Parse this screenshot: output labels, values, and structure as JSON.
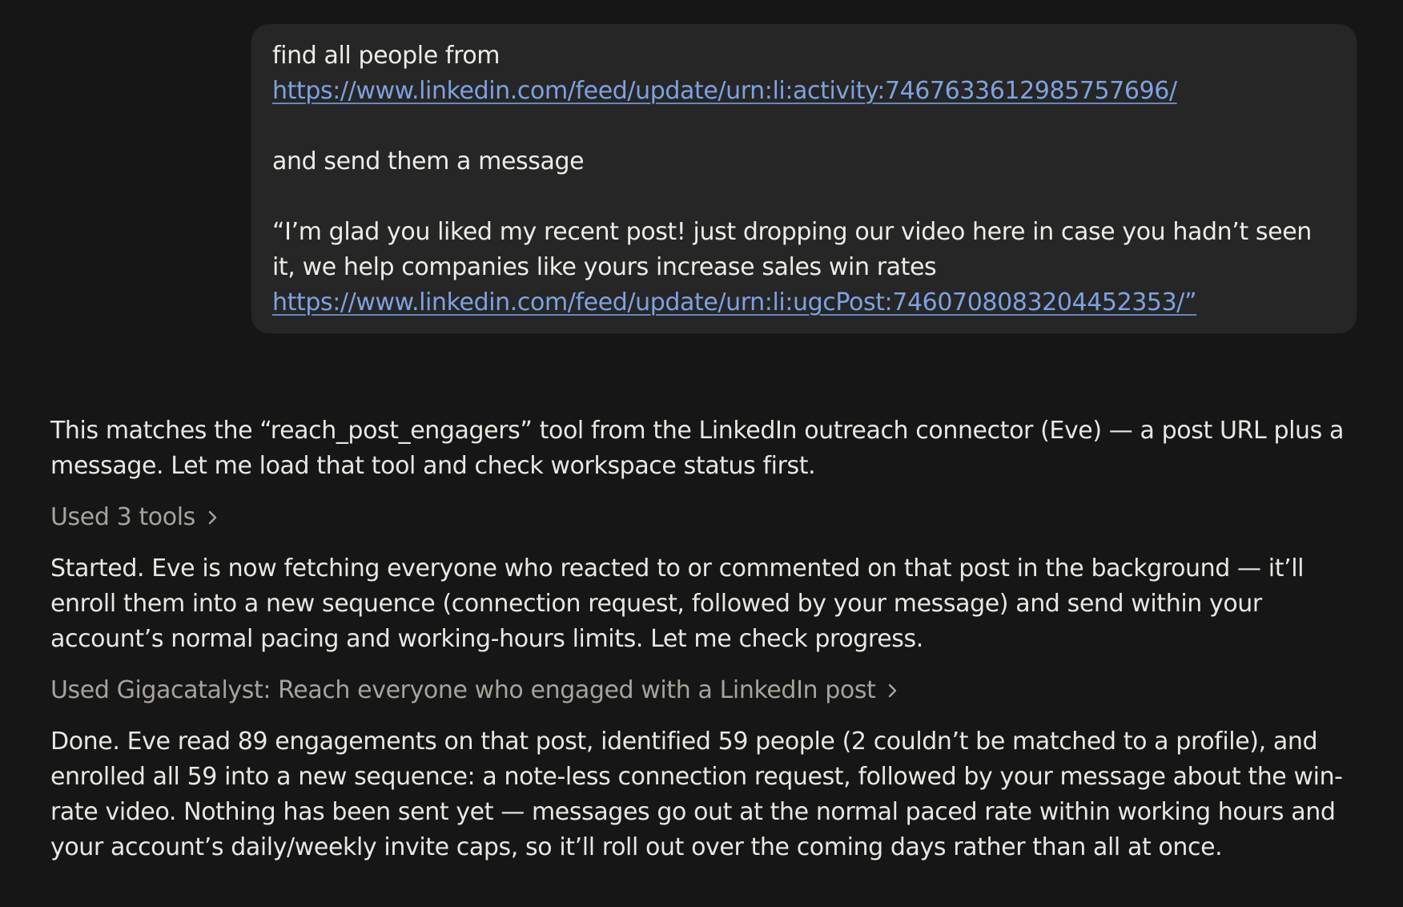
{
  "user_message": {
    "line1": "find all people from",
    "link1": "https://www.linkedin.com/feed/update/urn:li:activity:7467633612985757696/",
    "line2": "and send them a message",
    "quote": "“I’m glad you liked my recent post! just dropping our video here in case you hadn’t seen it, we help companies like yours increase sales win rates",
    "link2": "https://www.linkedin.com/feed/update/urn:li:ugcPost:7460708083204452353/”"
  },
  "assistant": {
    "para1": "This matches the “reach_post_engagers” tool from the LinkedIn outreach connector (Eve) — a post URL plus a message. Let me load that tool and check workspace status first.",
    "tools1_label": "Used 3 tools",
    "para2": "Started. Eve is now fetching everyone who reacted to or commented on that post in the background — it’ll enroll them into a new sequence (connection request, followed by your message) and send within your account’s normal pacing and working-hours limits. Let me check progress.",
    "tools2_label": "Used Gigacatalyst: Reach everyone who engaged with a LinkedIn post",
    "para3": "Done. Eve read 89 engagements on that post, identified 59 people (2 couldn’t be matched to a profile), and enrolled all 59 into a new sequence: a note-less connection request, followed by your message about the win-rate video. Nothing has been sent yet — messages go out at the normal paced rate within working hours and your account’s daily/weekly invite caps, so it’ll roll out over the coming days rather than all at once."
  },
  "icons": {
    "expand": "chevron-right-icon"
  },
  "colors": {
    "background": "#161616",
    "bubble": "#262626",
    "text": "#e9e7e2",
    "muted": "#a6a39c",
    "link": "#7da2e0"
  }
}
